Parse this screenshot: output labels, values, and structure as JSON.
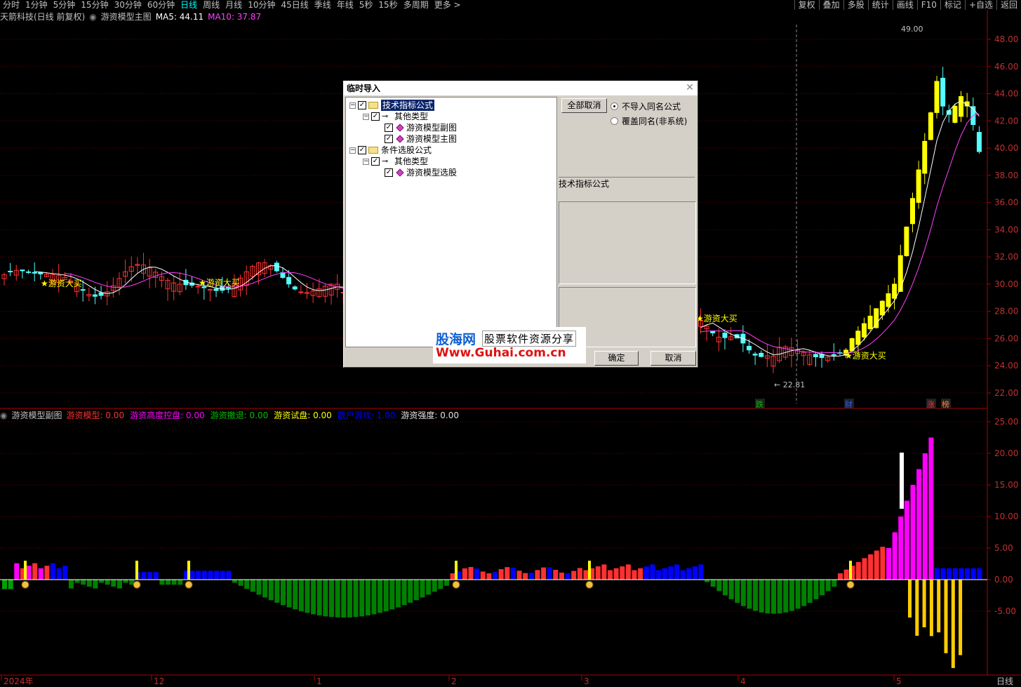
{
  "toolbar": {
    "periods": [
      "分时",
      "1分钟",
      "5分钟",
      "15分钟",
      "30分钟",
      "60分钟",
      "日线",
      "周线",
      "月线",
      "10分钟",
      "45日线",
      "季线",
      "年线",
      "5秒",
      "15秒",
      "多周期",
      "更多 >"
    ],
    "active_period": "日线",
    "tools": [
      "复权",
      "叠加",
      "多股",
      "统计",
      "画线",
      "F10",
      "标记",
      "+自选",
      "返回"
    ]
  },
  "main_chart": {
    "stock": "天箭科技(日线 前复权)",
    "indicator": "游资模型主图",
    "ma5": "MA5: 44.11",
    "ma10": "MA10: 37.87",
    "y_ticks": [
      "48.00",
      "46.00",
      "44.00",
      "42.00",
      "40.00",
      "38.00",
      "36.00",
      "34.00",
      "32.00",
      "30.00",
      "28.00",
      "26.00",
      "24.00",
      "22.00"
    ],
    "high_label": "49.00",
    "low_label": "22.81",
    "buy_label": "游资大买",
    "event_tags": [
      "跌",
      "财",
      "涨",
      "榜"
    ]
  },
  "sub_chart": {
    "indicator": "游资模型副图",
    "legend": [
      {
        "text": "游资模型: 0.00",
        "color": "#ff3030"
      },
      {
        "text": "游资高度控盘: 0.00",
        "color": "#ff00ff"
      },
      {
        "text": "游资撤退: 0.00",
        "color": "#00c000"
      },
      {
        "text": "游资试盘: 0.00",
        "color": "#ffff00"
      },
      {
        "text": "散户游戏: 1.00",
        "color": "#0000ff"
      },
      {
        "text": "游资强度: 0.00",
        "color": "#e0e0e0"
      }
    ],
    "y_ticks": [
      "25.00",
      "20.00",
      "15.00",
      "10.00",
      "5.00",
      "0.00",
      "-5.00"
    ]
  },
  "x_axis": [
    "2024年",
    "12",
    "1",
    "2",
    "3",
    "4",
    "5"
  ],
  "period_label": "日线",
  "dialog": {
    "title": "临时导入",
    "tree": [
      {
        "label": "技术指标公式",
        "level": 0,
        "kind": "folder"
      },
      {
        "label": "其他类型",
        "level": 1,
        "kind": "key"
      },
      {
        "label": "游资模型副图",
        "level": 2,
        "kind": "item"
      },
      {
        "label": "游资模型主图",
        "level": 2,
        "kind": "item"
      },
      {
        "label": "条件选股公式",
        "level": 0,
        "kind": "folder"
      },
      {
        "label": "其他类型",
        "level": 1,
        "kind": "key"
      },
      {
        "label": "游资模型选股",
        "level": 2,
        "kind": "item"
      }
    ],
    "cancel_all": "全部取消",
    "radio1": "不导入同名公式",
    "radio2": "覆盖同名(非系统)",
    "group_label": "技术指标公式",
    "ok": "确定",
    "cancel": "取消"
  },
  "watermark": {
    "line1a": "股海网",
    "line1b": "股票软件资源分享",
    "line2": "Www.Guhai.com.cn"
  },
  "colors": {
    "up": "#ff3232",
    "down": "#54ffff",
    "ma5": "#ffffff",
    "ma10": "#ff40ff",
    "axis": "#b00000",
    "grid": "#7a0000"
  }
}
